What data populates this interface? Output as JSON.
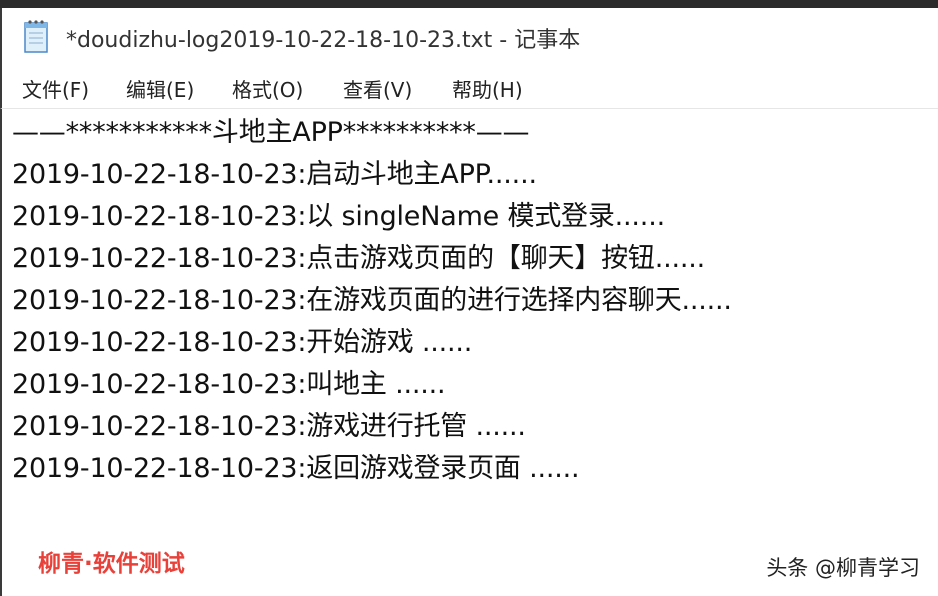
{
  "window": {
    "title": "*doudizhu-log2019-10-22-18-10-23.txt - 记事本",
    "icon": "notepad-icon"
  },
  "menu": {
    "items": [
      {
        "label": "文件(F)"
      },
      {
        "label": "编辑(E)"
      },
      {
        "label": "格式(O)"
      },
      {
        "label": "查看(V)"
      },
      {
        "label": "帮助(H)"
      }
    ]
  },
  "editor": {
    "lines": [
      "——***********斗地主APP**********——",
      "2019-10-22-18-10-23:启动斗地主APP......",
      "2019-10-22-18-10-23:以 singleName 模式登录......",
      "2019-10-22-18-10-23:点击游戏页面的【聊天】按钮......",
      "2019-10-22-18-10-23:在游戏页面的进行选择内容聊天......",
      "2019-10-22-18-10-23:开始游戏 ......",
      "2019-10-22-18-10-23:叫地主 ......",
      "2019-10-22-18-10-23:游戏进行托管 ......",
      "2019-10-22-18-10-23:返回游戏登录页面 ......"
    ]
  },
  "watermarks": {
    "left": "柳青·软件测试",
    "right": "头条 @柳青学习"
  },
  "colors": {
    "watermark_red": "#e8413a",
    "text": "#111111"
  }
}
